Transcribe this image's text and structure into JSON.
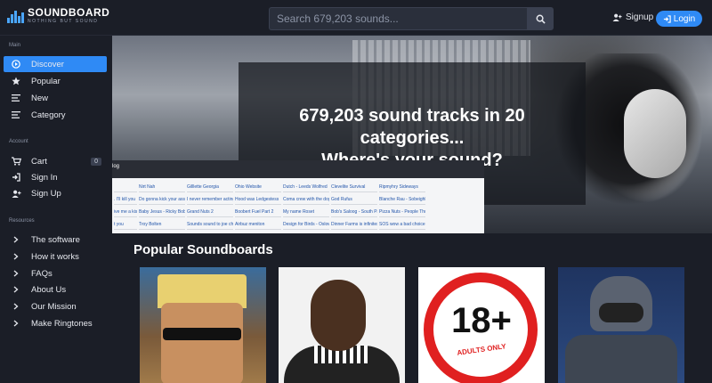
{
  "header": {
    "logo_name": "SOUNDBOARD",
    "logo_tagline": "NOTHING BUT SOUND",
    "search_placeholder": "Search 679,203 sounds...",
    "signup_label": "Signup",
    "login_label": "Login"
  },
  "sidebar": {
    "main_title": "Main",
    "main_items": [
      {
        "label": "Discover",
        "icon": "play-circle-icon",
        "active": true
      },
      {
        "label": "Popular",
        "icon": "star-icon"
      },
      {
        "label": "New",
        "icon": "list-icon"
      },
      {
        "label": "Category",
        "icon": "list-icon"
      }
    ],
    "account_title": "Account",
    "account_items": [
      {
        "label": "Cart",
        "icon": "cart-icon",
        "badge": "0"
      },
      {
        "label": "Sign In",
        "icon": "sign-in-icon"
      },
      {
        "label": "Sign Up",
        "icon": "user-plus-icon"
      }
    ],
    "resources_title": "Resources",
    "resources_items": [
      {
        "label": "The software",
        "icon": "chevron-right-icon"
      },
      {
        "label": "How it works",
        "icon": "chevron-right-icon"
      },
      {
        "label": "FAQs",
        "icon": "chevron-right-icon"
      },
      {
        "label": "About Us",
        "icon": "chevron-right-icon"
      },
      {
        "label": "Our Mission",
        "icon": "chevron-right-icon"
      },
      {
        "label": "Make Ringtones",
        "icon": "chevron-right-icon"
      }
    ]
  },
  "hero": {
    "line1": "679,203 sound tracks in 20",
    "line2": "categories...",
    "line3": "Where's your sound?",
    "table_label": "log",
    "table_rows": [
      [
        "",
        "Nirt Nah",
        "Gilllette Georgia",
        "Ohio Website",
        "Dutch - Leeds Wolfred",
        "Clevelite Survival",
        "Ripmyhry Sideways"
      ],
      [
        ". I'll kill you",
        "Do gonna kick your ass, bitch!",
        "I never remember acting y...",
        "Hood was Ledgestess",
        "Coma crew with the dogs",
        "God Rufus",
        "Blanche Rau - Sobeighlet"
      ],
      [
        "ive me a kiss",
        "Baby Jesus - Ricky Bobby",
        "Grand Nuts 2",
        "Boobert Fuel Part 2",
        "My name Roset",
        "Bob's Saloog - South Park",
        "Pizza Nuts - People Thunder"
      ],
      [
        "t you",
        "Troy Bolten",
        "Sounds sound to joe check...",
        "Airbuz meniton",
        "Design for Birds - Oslow",
        "Dinner Farms is infinites",
        "SOS wow a bad choice - Arn..."
      ]
    ]
  },
  "popular": {
    "title": "Popular Soundboards",
    "card3_text": "18+",
    "card3_sub": "ADULTS ONLY"
  },
  "colors": {
    "accent": "#2f8af5",
    "background": "#1b1e27",
    "age_red": "#e02020"
  }
}
